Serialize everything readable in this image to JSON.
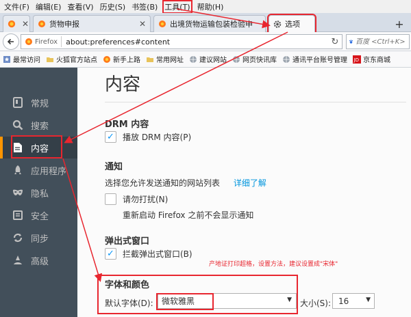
{
  "menubar": {
    "items": [
      "文件(F)",
      "编辑(E)",
      "查看(V)",
      "历史(S)",
      "书签(B)",
      "工具(T)",
      "帮助(H)"
    ]
  },
  "tabs": [
    {
      "label": "",
      "icon": "firefox-logo-icon"
    },
    {
      "label": "货物申报",
      "icon": "firefox-icon"
    },
    {
      "label": "出境货物运输包装检验申",
      "icon": "firefox-icon"
    },
    {
      "label": "选项",
      "icon": "gear-icon"
    }
  ],
  "navbar": {
    "badge": "Firefox",
    "url": "about:preferences#content",
    "search_placeholder": "百度 <Ctrl+K>"
  },
  "bookmarks": [
    {
      "label": "最常访问",
      "icon": "star-icon"
    },
    {
      "label": "火狐官方站点",
      "icon": "folder-icon"
    },
    {
      "label": "新手上路",
      "icon": "firefox-icon"
    },
    {
      "label": "常用网址",
      "icon": "folder-icon"
    },
    {
      "label": "建议网站",
      "icon": "globe-icon"
    },
    {
      "label": "网页快讯库",
      "icon": "globe-icon"
    },
    {
      "label": "通讯平台账号管理",
      "icon": "globe-icon"
    },
    {
      "label": "京东商城",
      "icon": "jd-icon"
    }
  ],
  "sidebar": {
    "items": [
      {
        "label": "常规",
        "icon": "general-icon"
      },
      {
        "label": "搜索",
        "icon": "search-icon"
      },
      {
        "label": "内容",
        "icon": "content-icon"
      },
      {
        "label": "应用程序",
        "icon": "applications-icon"
      },
      {
        "label": "隐私",
        "icon": "privacy-mask-icon"
      },
      {
        "label": "安全",
        "icon": "security-icon"
      },
      {
        "label": "同步",
        "icon": "sync-icon"
      },
      {
        "label": "高级",
        "icon": "advanced-icon"
      }
    ],
    "active_index": 2
  },
  "content": {
    "title": "内容",
    "drm": {
      "section_title": "DRM 内容",
      "checkbox_label": "播放 DRM 内容(P)",
      "checked": true
    },
    "notifications": {
      "section_title": "通知",
      "description": "选择您允许发送通知的网站列表",
      "learn_more": "详细了解",
      "checkbox_label": "请勿打扰(N)",
      "checked": false,
      "sub_text": "重新启动 Firefox 之前不会显示通知"
    },
    "popups": {
      "section_title": "弹出式窗口",
      "checkbox_label": "拦截弹出式窗口(B)",
      "checked": true
    },
    "fonts": {
      "section_title": "字体和颜色",
      "default_font_label": "默认字体(D):",
      "default_font_value": "微软雅黑",
      "size_label": "大小(S):",
      "size_value": "16"
    }
  },
  "annotation": {
    "note": "产地证打印超格，设置方法，建议设置成\"宋体\"",
    "color": "#e8262f"
  },
  "colors": {
    "sidebar_bg": "#424f5a",
    "sidebar_active_accent": "#ff9500",
    "link": "#0095dd",
    "checkbox_check": "#0996f8"
  }
}
